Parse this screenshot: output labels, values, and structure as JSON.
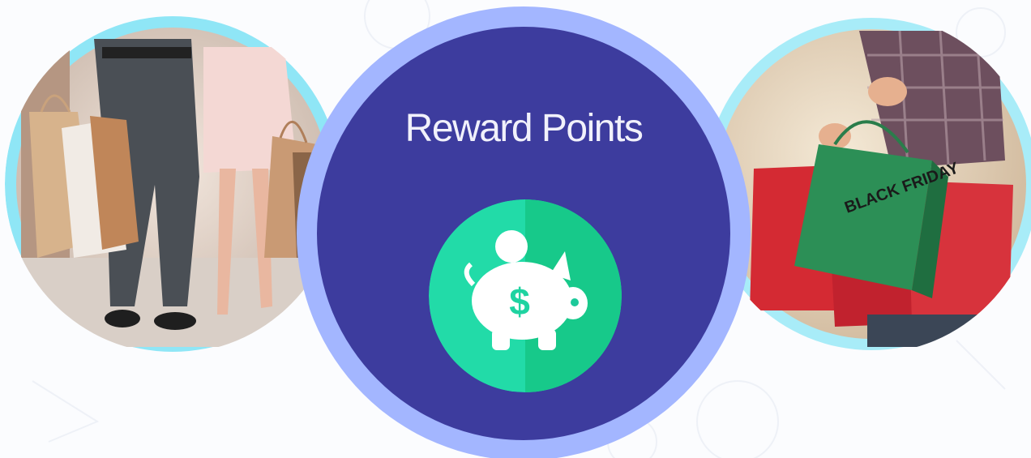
{
  "card": {
    "title": "Reward Points",
    "icon": "piggy-bank-dollar-icon"
  },
  "photos": {
    "left": "couple-shopping-bags-photo",
    "right": "black-friday-shopping-bags-photo",
    "bag_text": "BLACK FRIDAY"
  },
  "colors": {
    "disc": "#3d3c9e",
    "ring": "#a3b6ff",
    "photo_ring": "#8fe6f6",
    "badge_light": "#22dba8",
    "badge_dark": "#17c98a"
  }
}
